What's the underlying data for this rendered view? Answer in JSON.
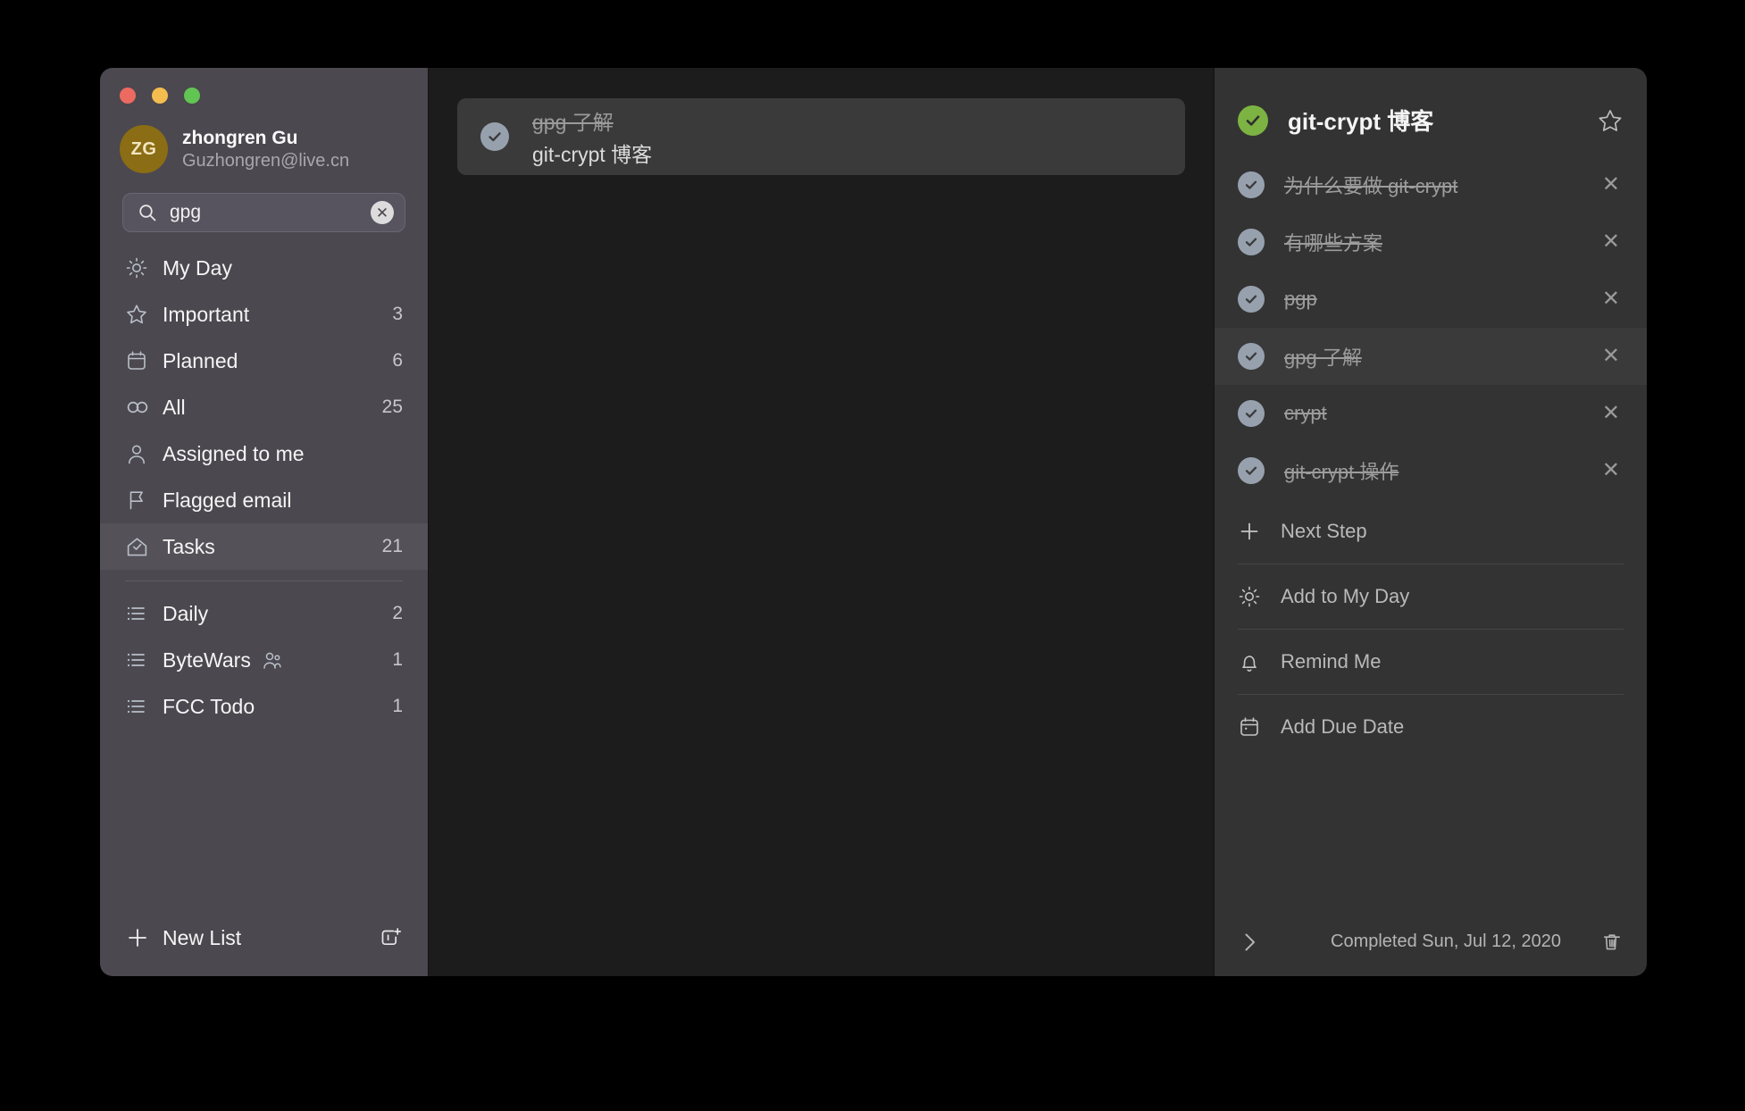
{
  "window": {
    "traffic_lights": [
      "close",
      "minimize",
      "zoom"
    ]
  },
  "sidebar": {
    "account": {
      "initials": "ZG",
      "name": "zhongren Gu",
      "email": "Guzhongren@live.cn",
      "avatar_color": "#8a6d14"
    },
    "search": {
      "icon": "search-icon",
      "value": "gpg",
      "placeholder": "Search",
      "clear_label": "✕"
    },
    "nav": [
      {
        "icon": "sun-icon",
        "label": "My Day",
        "count": "",
        "selected": false
      },
      {
        "icon": "star-icon",
        "label": "Important",
        "count": "3",
        "selected": false
      },
      {
        "icon": "calendar-icon",
        "label": "Planned",
        "count": "6",
        "selected": false
      },
      {
        "icon": "infinity-icon",
        "label": "All",
        "count": "25",
        "selected": false
      },
      {
        "icon": "person-icon",
        "label": "Assigned to me",
        "count": "",
        "selected": false
      },
      {
        "icon": "flag-icon",
        "label": "Flagged email",
        "count": "",
        "selected": false
      },
      {
        "icon": "house-check-icon",
        "label": "Tasks",
        "count": "21",
        "selected": true
      }
    ],
    "lists": [
      {
        "icon": "list-icon",
        "label": "Daily",
        "count": "2",
        "shared": false
      },
      {
        "icon": "list-icon",
        "label": "ByteWars",
        "count": "1",
        "shared": true
      },
      {
        "icon": "list-icon",
        "label": "FCC Todo",
        "count": "1",
        "shared": false
      }
    ],
    "footer": {
      "new_list_label": "New List",
      "new_list_icon": "plus-icon",
      "new_group_icon": "new-group-icon"
    }
  },
  "center": {
    "results": [
      {
        "checked": true,
        "title": "gpg 了解",
        "subtitle": "git-crypt 博客"
      }
    ]
  },
  "detail": {
    "checked": true,
    "title": "git-crypt 博客",
    "star_icon": "star-icon",
    "accent_green": "#7cb342",
    "subtasks": [
      {
        "label": "为什么要做 git-crypt",
        "done": true,
        "highlight": false
      },
      {
        "label": "有哪些方案",
        "done": true,
        "highlight": false
      },
      {
        "label": "pgp",
        "done": true,
        "highlight": false
      },
      {
        "label": "gpg 了解",
        "done": true,
        "highlight": true
      },
      {
        "label": "crypt",
        "done": true,
        "highlight": false
      },
      {
        "label": "git-crypt 操作",
        "done": true,
        "highlight": false
      }
    ],
    "remove_label": "✕",
    "actions": [
      {
        "icon": "plus-icon",
        "label": "Next Step"
      },
      {
        "icon": "sun-icon",
        "label": "Add to My Day"
      },
      {
        "icon": "bell-icon",
        "label": "Remind Me"
      },
      {
        "icon": "calendar-icon",
        "label": "Add Due Date"
      }
    ],
    "footer": {
      "collapse_icon": "chevron-right-icon",
      "completed_text": "Completed Sun, Jul 12, 2020",
      "delete_icon": "trash-icon"
    }
  }
}
